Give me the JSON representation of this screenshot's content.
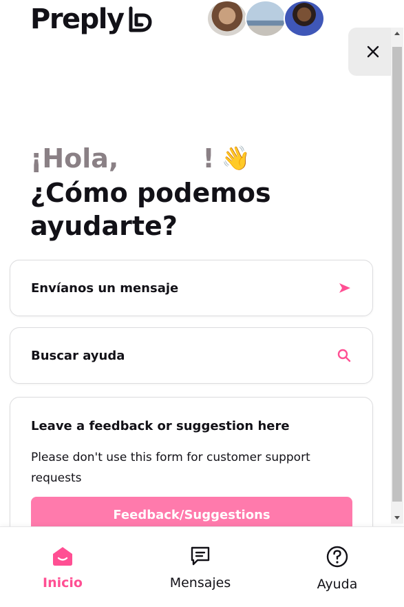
{
  "brand": {
    "name": "Preply"
  },
  "avatars": [
    "avatar-1",
    "avatar-2",
    "avatar-3"
  ],
  "close_icon": "close-icon",
  "greeting": {
    "hola": "¡Hola,",
    "exclaim": "!",
    "wave": "👋",
    "question": "¿Cómo podemos ayudarte?"
  },
  "actions": {
    "send_label": "Envíanos un mensaje",
    "send_icon": "send-icon",
    "search_label": "Buscar ayuda",
    "search_icon": "search-icon"
  },
  "feedback": {
    "title": "Leave a feedback or suggestion here",
    "text": "Please don't use this form for customer support requests",
    "button_label": "Feedback/Suggestions"
  },
  "nav": {
    "items": [
      {
        "label": "Inicio",
        "icon": "home-icon",
        "active": true
      },
      {
        "label": "Mensajes",
        "icon": "messages-icon",
        "active": false
      },
      {
        "label": "Ayuda",
        "icon": "help-icon",
        "active": false
      }
    ]
  },
  "colors": {
    "accent": "#ff4f93",
    "button": "#ff7aac",
    "text": "#121117",
    "muted_greeting": "#8a8085"
  }
}
